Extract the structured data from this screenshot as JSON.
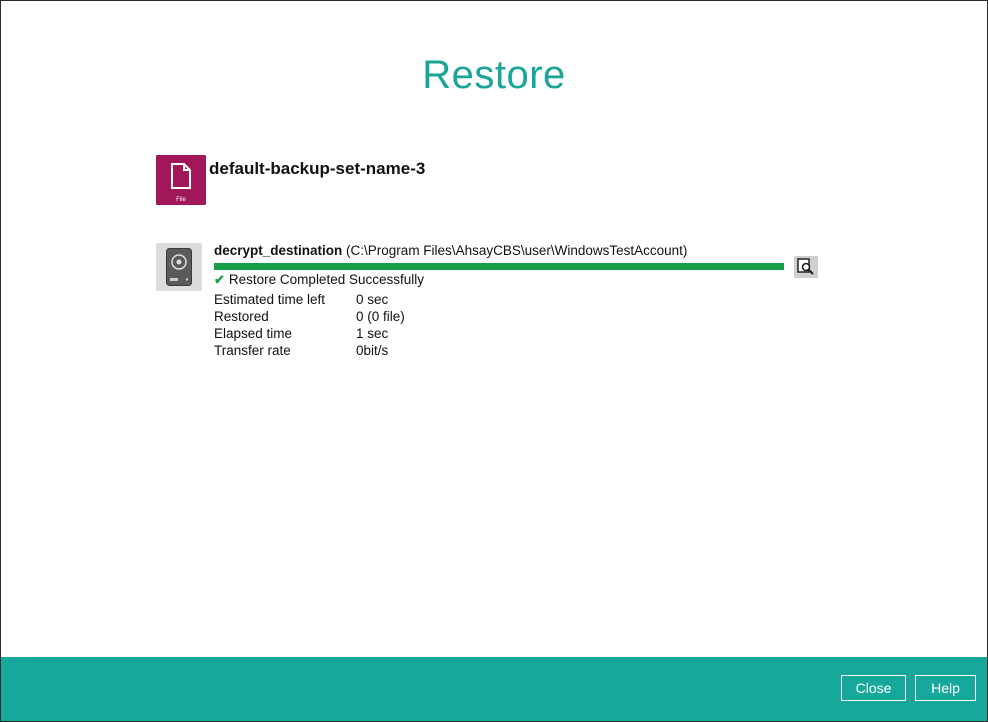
{
  "header": {
    "title": "Restore"
  },
  "backup_set": {
    "name": "default-backup-set-name-3",
    "icon": "file-icon",
    "icon_caption": "File",
    "icon_color": "#a0185a"
  },
  "destination": {
    "name": "decrypt_destination",
    "path": "(C:\\Program Files\\AhsayCBS\\user\\WindowsTestAccount)",
    "icon": "hard-drive-icon",
    "progress": 1.0,
    "status": "Restore Completed Successfully",
    "status_icon": "checkmark-icon",
    "browse_icon": "magnify-document-icon"
  },
  "stats": [
    {
      "label": "Estimated time left",
      "value": "0 sec"
    },
    {
      "label": "Restored",
      "value": "0 (0 file)"
    },
    {
      "label": "Elapsed time",
      "value": "1 sec"
    },
    {
      "label": "Transfer rate",
      "value": "0bit/s"
    }
  ],
  "footer": {
    "close_label": "Close",
    "help_label": "Help"
  },
  "colors": {
    "accent": "#1aa597",
    "footer": "#17a89b",
    "progress": "#17a04a",
    "success": "#1aa04a"
  }
}
